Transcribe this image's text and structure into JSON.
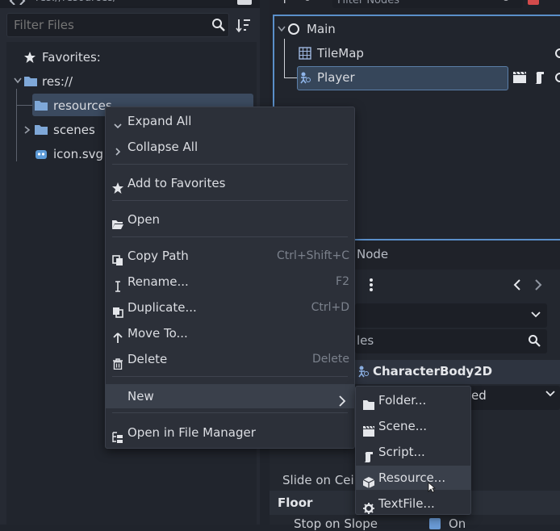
{
  "filesystem": {
    "path": "res://resources/",
    "filter_placeholder": "Filter Files",
    "favorites_label": "Favorites:",
    "root_label": "res://",
    "items": [
      {
        "label": "resources"
      },
      {
        "label": "scenes"
      },
      {
        "label": "icon.svg"
      }
    ]
  },
  "scene": {
    "filter_placeholder": "Filter Nodes",
    "nodes": [
      {
        "label": "Main"
      },
      {
        "label": "TileMap"
      },
      {
        "label": "Player"
      }
    ]
  },
  "context_menu": {
    "items": [
      {
        "label": "Expand All",
        "icon": "chevron-down-icon"
      },
      {
        "label": "Collapse All",
        "icon": "chevron-right-icon"
      },
      {
        "label": "Add to Favorites",
        "icon": "star-icon"
      },
      {
        "label": "Open",
        "icon": "folder-open-icon"
      },
      {
        "label": "Copy Path",
        "shortcut": "Ctrl+Shift+C",
        "icon": "copy-icon"
      },
      {
        "label": "Rename...",
        "shortcut": "F2",
        "icon": "text-cursor-icon"
      },
      {
        "label": "Duplicate...",
        "shortcut": "Ctrl+D",
        "icon": "duplicate-icon"
      },
      {
        "label": "Move To...",
        "icon": "move-up-icon"
      },
      {
        "label": "Delete",
        "shortcut": "Delete",
        "icon": "trash-icon"
      },
      {
        "label": "New",
        "icon": "chevron-right-icon"
      },
      {
        "label": "Open in File Manager",
        "icon": "filesystem-icon"
      }
    ]
  },
  "new_submenu": {
    "items": [
      {
        "label": "Folder...",
        "icon": "folder-icon"
      },
      {
        "label": "Scene...",
        "icon": "clapper-icon"
      },
      {
        "label": "Script...",
        "icon": "script-icon"
      },
      {
        "label": "Resource...",
        "icon": "resource-icon"
      },
      {
        "label": "TextFile...",
        "icon": "gear-icon"
      }
    ]
  },
  "inspector": {
    "tab_node": "Node",
    "filter_placeholder_fragment": "les",
    "class_name": "CharacterBody2D",
    "mode_fragment": "ed",
    "slide_on_ceiling_fragment": "Slide on Ceili",
    "floor_section": "Floor",
    "stop_on_slope_fragment": "Stop on Slope",
    "stop_on_slope_value": "On"
  },
  "colors": {
    "accent": "#5a8fc9",
    "folder": "#7fa8d8",
    "selection": "#3b4a5f"
  }
}
